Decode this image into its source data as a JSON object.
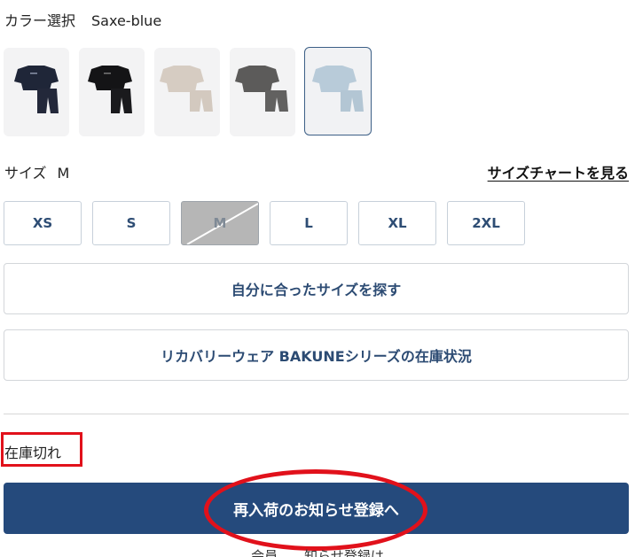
{
  "color": {
    "label": "カラー選択",
    "value": "Saxe-blue"
  },
  "swatches": [
    {
      "name": "navy",
      "top": "#1f2638",
      "bottom": "#23283a",
      "selected": false
    },
    {
      "name": "black",
      "top": "#141416",
      "bottom": "#1a1a1d",
      "selected": false
    },
    {
      "name": "beige",
      "top": "#d6ccc2",
      "bottom": "#d3c9bf",
      "selected": false
    },
    {
      "name": "gray",
      "top": "#5c5b5a",
      "bottom": "#626160",
      "selected": false
    },
    {
      "name": "saxe-blue",
      "top": "#b8cbd9",
      "bottom": "#b3c6d4",
      "selected": true
    }
  ],
  "size": {
    "label": "サイズ",
    "value": "M",
    "chart_link": "サイズチャートを見る"
  },
  "sizes": [
    {
      "label": "XS",
      "available": true
    },
    {
      "label": "S",
      "available": true
    },
    {
      "label": "M",
      "available": false
    },
    {
      "label": "L",
      "available": true
    },
    {
      "label": "XL",
      "available": true
    },
    {
      "label": "2XL",
      "available": true
    }
  ],
  "find_size_button": "自分に合ったサイズを探す",
  "series_stock_button": "リカバリーウェア BAKUNEシリーズの在庫状況",
  "stock_status": "在庫切れ",
  "notify_button": "再入荷のお知らせ登録へ",
  "cutoff_text": "会員……知らせ登録は",
  "colors": {
    "accent": "#254a7c",
    "highlight": "#e1111b",
    "text_link": "#2e4d74"
  }
}
